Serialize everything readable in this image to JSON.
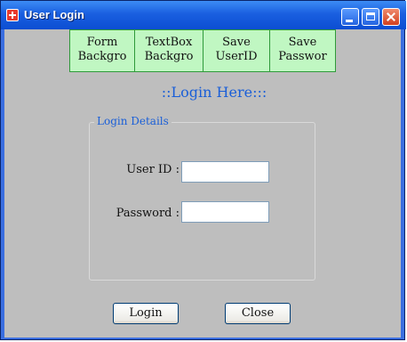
{
  "window": {
    "title": "User Login",
    "icons": [
      "app-icon",
      "minimize-icon",
      "maximize-icon",
      "close-icon"
    ]
  },
  "toolbar": {
    "buttons": [
      {
        "label": "Form\nBackgro"
      },
      {
        "label": "TextBox\nBackgro"
      },
      {
        "label": "Save\nUserID"
      },
      {
        "label": "Save\nPasswor"
      }
    ]
  },
  "heading": "::Login Here:::",
  "login_group": {
    "legend": "Login Details",
    "user_id_label": "User ID :",
    "user_id_value": "",
    "password_label": "Password :",
    "password_value": ""
  },
  "actions": {
    "login_label": "Login",
    "close_label": "Close"
  },
  "colors": {
    "titlebar": "#0b4ed2",
    "client_bg": "#bebebe",
    "toolbar_button_bg": "#c0f7c2",
    "accent_text": "#1a5fd8"
  }
}
